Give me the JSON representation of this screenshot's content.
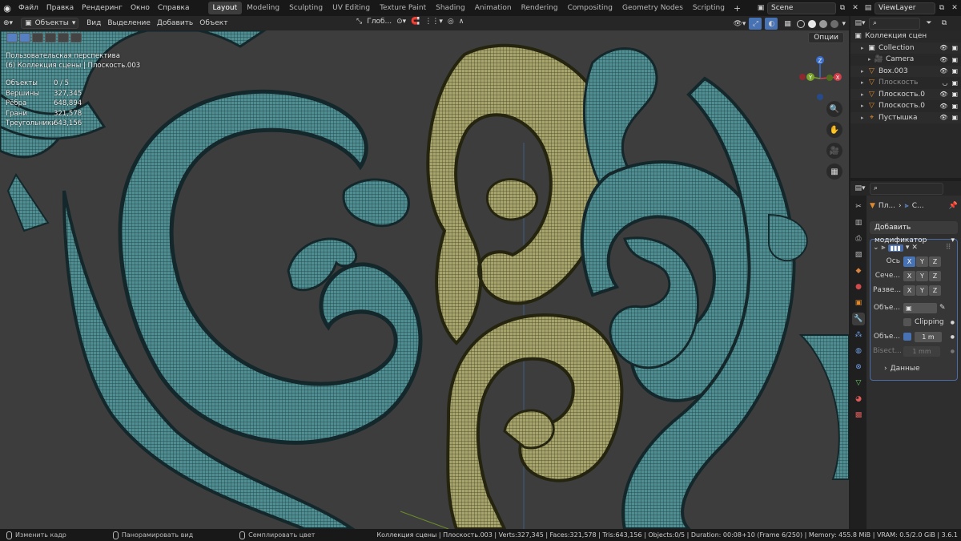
{
  "app": {
    "menu": [
      "Файл",
      "Правка",
      "Рендеринг",
      "Окно",
      "Справка"
    ],
    "workspaces": [
      "Layout",
      "Modeling",
      "Sculpting",
      "UV Editing",
      "Texture Paint",
      "Shading",
      "Animation",
      "Rendering",
      "Compositing",
      "Geometry Nodes",
      "Scripting"
    ],
    "active_workspace": "Layout",
    "add_workspace": "+",
    "scene_name": "Scene",
    "view_layer": "ViewLayer"
  },
  "viewport_header": {
    "mode": "Объекты",
    "menus": [
      "Вид",
      "Выделение",
      "Добавить",
      "Объект"
    ],
    "transform_orientation": "Глоб...",
    "options": "Опции"
  },
  "viewport": {
    "view_name": "Пользовательская перспектива",
    "collection_info": "(6) Коллекция сцены | Плоскость.003",
    "stats": [
      {
        "label": "Объекты",
        "value": "0 / 5"
      },
      {
        "label": "Вершины",
        "value": "327,345"
      },
      {
        "label": "Рёбра",
        "value": "648,894"
      },
      {
        "label": "Грани",
        "value": "321,578"
      },
      {
        "label": "Треугольники",
        "value": "643,156"
      }
    ],
    "gizmo": {
      "x": "X",
      "y": "Y",
      "z": "Z"
    }
  },
  "outliner": {
    "root": "Коллекция сцен",
    "items": [
      {
        "name": "Collection",
        "icon": "collection-icon",
        "indent": 1,
        "dim": false
      },
      {
        "name": "Camera",
        "icon": "camera-icon",
        "indent": 2,
        "dim": false
      },
      {
        "name": "Box.003",
        "icon": "mesh-icon",
        "indent": 1,
        "dim": false
      },
      {
        "name": "Плоскость",
        "icon": "mesh-icon",
        "indent": 1,
        "dim": true
      },
      {
        "name": "Плоскость.0",
        "icon": "mesh-icon",
        "indent": 1,
        "dim": false
      },
      {
        "name": "Плоскость.0",
        "icon": "mesh-icon",
        "indent": 1,
        "dim": false
      },
      {
        "name": "Пустышка",
        "icon": "empty-icon",
        "indent": 1,
        "dim": false
      }
    ]
  },
  "properties": {
    "breadcrumb_obj": "Пл...",
    "breadcrumb_mod": "С...",
    "add_modifier": "Добавить модификатор",
    "modifier": {
      "axis_label": "Ось",
      "bisect_label": "Сече...",
      "flip_label": "Разве...",
      "axes": [
        "X",
        "Y",
        "Z"
      ],
      "object_label": "Объе...",
      "clipping_label": "Clipping",
      "merge_label": "Объе...",
      "merge_value": "1 m",
      "bisect_dist_label": "Bisect...",
      "bisect_dist_value": "1 mm",
      "data_label": "Данные"
    }
  },
  "statusbar": {
    "hints": [
      "Изменить кадр",
      "Панорамировать вид",
      "Семплировать цвет"
    ],
    "info": "Коллекция сцены | Плоскость.003 | Verts:327,345 | Faces:321,578 | Tris:643,156 | Objects:0/5 | Duration: 00:08+10 (Frame 6/250) | Memory: 455.8 MiB | VRAM: 0.5/2.0 GiB | 3.6.1"
  },
  "colors": {
    "teal_mesh": "#4f8f93",
    "olive_mesh": "#a7a46c",
    "viewport_bg": "#3d3d3d",
    "accent": "#4772b3"
  }
}
